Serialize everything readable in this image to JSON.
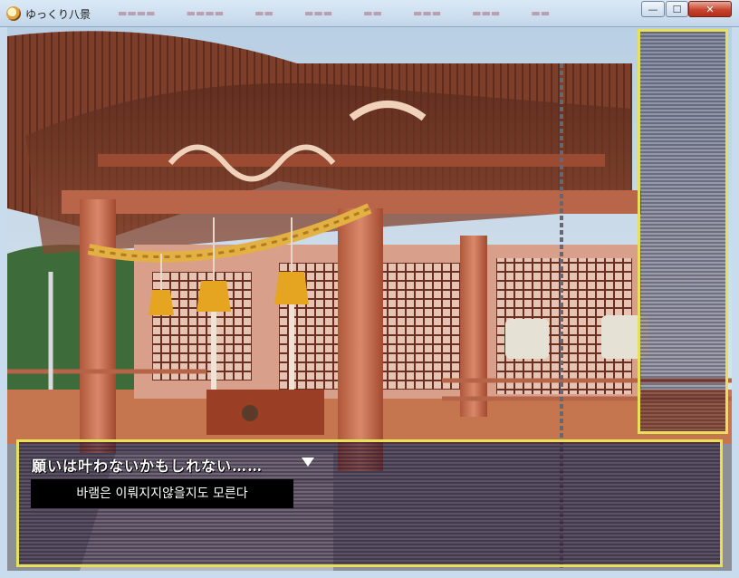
{
  "window": {
    "title": "ゆっくり八景",
    "minimize_icon": "minimize-icon",
    "maximize_icon": "maximize-icon",
    "close_icon": "close-icon"
  },
  "dialogue": {
    "text": "願いは叶わないかもしれない……",
    "continue_icon": "continue-arrow-icon",
    "translation": "바램은 이뤄지지않을지도 모른다"
  },
  "colors": {
    "window_border": "#e6e05a",
    "message_background": "#26163a"
  }
}
